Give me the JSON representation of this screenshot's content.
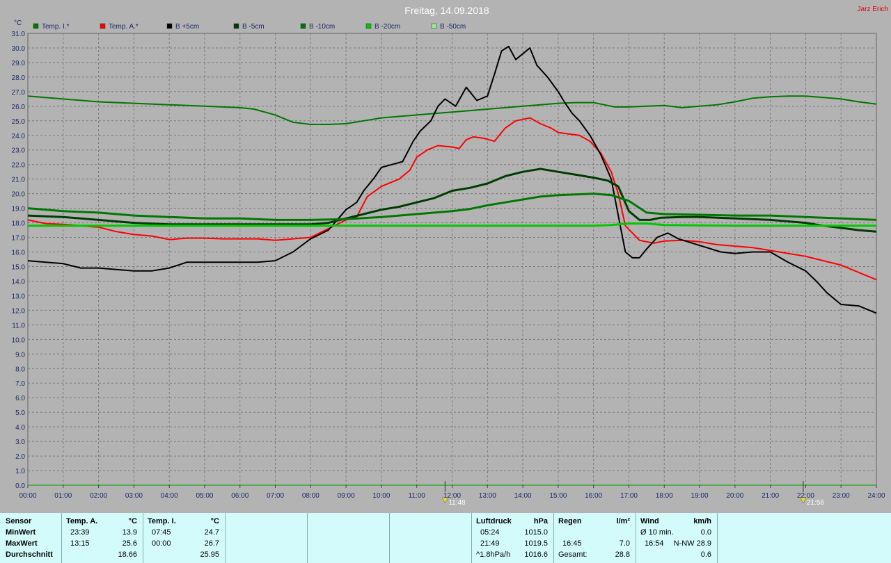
{
  "header": {
    "title": "Freitag, 14.09.2018",
    "author": "Jarz Erich"
  },
  "chart_data": {
    "type": "line",
    "ylabel": "°C",
    "ylim": [
      0,
      31
    ],
    "y_ticks": [
      "0.0",
      "1.0",
      "2.0",
      "3.0",
      "4.0",
      "5.0",
      "6.0",
      "7.0",
      "8.0",
      "9.0",
      "10.0",
      "11.0",
      "12.0",
      "13.0",
      "14.0",
      "15.0",
      "16.0",
      "17.0",
      "18.0",
      "19.0",
      "20.0",
      "21.0",
      "22.0",
      "23.0",
      "24.0",
      "25.0",
      "26.0",
      "27.0",
      "28.0",
      "29.0",
      "30.0",
      "31.0"
    ],
    "x_ticks": [
      "00:00",
      "01:00",
      "02:00",
      "03:00",
      "04:00",
      "05:00",
      "06:00",
      "07:00",
      "08:00",
      "09:00",
      "10:00",
      "11:00",
      "12:00",
      "13:00",
      "14:00",
      "15:00",
      "16:00",
      "17:00",
      "18:00",
      "19:00",
      "20:00",
      "21:00",
      "22:00",
      "23:00",
      "24:00"
    ],
    "xlim": [
      0,
      24
    ],
    "grid": true,
    "legend_position": "top",
    "markers": [
      {
        "time_hours": 11.8,
        "label": "11:48"
      },
      {
        "time_hours": 21.93,
        "label": "21:56"
      }
    ],
    "series": [
      {
        "name": "Temp. I.*",
        "color": "#007800",
        "width": 2,
        "x": [
          0,
          1,
          2,
          3,
          4,
          5,
          6,
          6.4,
          7,
          7.5,
          8,
          8.5,
          9,
          9.5,
          10,
          10.5,
          11,
          11.5,
          12,
          12.5,
          13,
          13.5,
          14,
          14.5,
          15,
          15.5,
          16,
          16.3,
          16.6,
          17,
          17.5,
          18,
          18.5,
          19,
          19.5,
          20,
          20.5,
          21,
          21.5,
          22,
          22.5,
          23,
          23.5,
          24
        ],
        "y": [
          26.7,
          26.5,
          26.3,
          26.2,
          26.1,
          26.0,
          25.9,
          25.8,
          25.4,
          24.9,
          24.75,
          24.75,
          24.8,
          25.0,
          25.2,
          25.3,
          25.4,
          25.5,
          25.6,
          25.7,
          25.8,
          25.9,
          26.0,
          26.1,
          26.2,
          26.25,
          26.25,
          26.1,
          25.95,
          25.95,
          26.0,
          26.05,
          25.9,
          26.0,
          26.1,
          26.3,
          26.55,
          26.65,
          26.7,
          26.7,
          26.6,
          26.5,
          26.3,
          26.15
        ]
      },
      {
        "name": "Temp. A.*",
        "color": "#ff0000",
        "width": 2,
        "x": [
          0,
          0.5,
          1,
          1.5,
          2,
          2.5,
          3,
          3.5,
          4,
          4.5,
          5,
          5.5,
          6,
          6.5,
          7,
          7.5,
          8,
          8.5,
          9,
          9.3,
          9.6,
          10,
          10.5,
          10.8,
          11,
          11.3,
          11.6,
          12,
          12.2,
          12.4,
          12.6,
          12.9,
          13.2,
          13.5,
          13.8,
          14,
          14.2,
          14.5,
          14.8,
          15,
          15.3,
          15.6,
          15.9,
          16.2,
          16.5,
          16.7,
          16.9,
          17.3,
          17.7,
          18,
          18.5,
          19,
          19.5,
          20,
          20.5,
          21,
          21.5,
          22,
          22.5,
          23,
          23.5,
          24
        ],
        "y": [
          18.2,
          17.95,
          17.9,
          17.8,
          17.7,
          17.4,
          17.2,
          17.1,
          16.85,
          16.95,
          16.95,
          16.9,
          16.9,
          16.9,
          16.8,
          16.9,
          17.0,
          17.6,
          18.2,
          18.4,
          19.8,
          20.5,
          21.0,
          21.6,
          22.5,
          23.0,
          23.3,
          23.2,
          23.1,
          23.7,
          23.9,
          23.8,
          23.6,
          24.5,
          25.0,
          25.1,
          25.2,
          24.8,
          24.5,
          24.2,
          24.1,
          24.0,
          23.6,
          22.8,
          21.5,
          20.0,
          17.8,
          16.8,
          16.6,
          16.75,
          16.8,
          16.7,
          16.5,
          16.4,
          16.3,
          16.1,
          15.9,
          15.7,
          15.4,
          15.1,
          14.6,
          14.1
        ]
      },
      {
        "name": "B +5cm",
        "color": "#000000",
        "width": 2,
        "x": [
          0,
          0.5,
          1,
          1.5,
          2,
          2.5,
          3,
          3.5,
          4,
          4.5,
          5,
          5.5,
          6,
          6.5,
          7,
          7.5,
          8,
          8.5,
          9,
          9.3,
          9.5,
          9.8,
          10,
          10.3,
          10.6,
          10.9,
          11.1,
          11.4,
          11.6,
          11.8,
          12.1,
          12.4,
          12.7,
          13.0,
          13.2,
          13.4,
          13.6,
          13.8,
          14.1,
          14.2,
          14.4,
          14.7,
          15.0,
          15.2,
          15.4,
          15.6,
          15.9,
          16.2,
          16.5,
          16.7,
          16.9,
          17.1,
          17.3,
          17.5,
          17.8,
          18.1,
          18.4,
          18.8,
          19.2,
          19.6,
          20,
          20.5,
          21,
          21.5,
          22,
          22.3,
          22.6,
          23,
          23.5,
          24
        ],
        "y": [
          15.4,
          15.3,
          15.2,
          14.9,
          14.9,
          14.8,
          14.7,
          14.7,
          14.9,
          15.3,
          15.3,
          15.3,
          15.3,
          15.3,
          15.4,
          16.0,
          16.9,
          17.5,
          18.9,
          19.4,
          20.2,
          21.1,
          21.8,
          22.0,
          22.2,
          23.6,
          24.3,
          25.0,
          26.0,
          26.5,
          26.0,
          27.3,
          26.4,
          26.7,
          28.2,
          29.8,
          30.1,
          29.2,
          29.8,
          30.0,
          28.8,
          28.0,
          27.0,
          26.2,
          25.5,
          25.0,
          24.0,
          22.7,
          21.0,
          18.5,
          16.0,
          15.6,
          15.6,
          16.2,
          17.0,
          17.3,
          16.9,
          16.6,
          16.3,
          16.0,
          15.9,
          16.0,
          16.0,
          15.3,
          14.7,
          14.0,
          13.2,
          12.4,
          12.3,
          11.8
        ]
      },
      {
        "name": "B -5cm",
        "color": "#003c00",
        "width": 3,
        "x": [
          0,
          1,
          2,
          3,
          4,
          5,
          5.4,
          8,
          8.5,
          9,
          9.5,
          10,
          10.5,
          11,
          11.5,
          12,
          12.5,
          13,
          13.5,
          14,
          14.5,
          15,
          15.5,
          16,
          16.4,
          16.7,
          17,
          17.3,
          17.6,
          17.9,
          18.5,
          19,
          20,
          21,
          22,
          22.5,
          23,
          23.5,
          24
        ],
        "y": [
          18.5,
          18.4,
          18.2,
          18.0,
          17.9,
          17.9,
          17.9,
          17.9,
          18.0,
          18.3,
          18.6,
          18.9,
          19.1,
          19.4,
          19.7,
          20.2,
          20.4,
          20.7,
          21.2,
          21.5,
          21.7,
          21.5,
          21.3,
          21.1,
          20.9,
          20.5,
          18.8,
          18.2,
          18.2,
          18.35,
          18.4,
          18.4,
          18.3,
          18.2,
          18.0,
          17.8,
          17.65,
          17.5,
          17.4
        ]
      },
      {
        "name": "B -10cm",
        "color": "#007800",
        "width": 3,
        "x": [
          0,
          1,
          2,
          3,
          4,
          5,
          6,
          7,
          8,
          9,
          10,
          11,
          12,
          12.5,
          13,
          13.5,
          14,
          14.5,
          15,
          15.5,
          16,
          16.5,
          17,
          17.5,
          18,
          19,
          20,
          21,
          22,
          23,
          24
        ],
        "y": [
          19.0,
          18.8,
          18.7,
          18.5,
          18.4,
          18.3,
          18.3,
          18.2,
          18.2,
          18.25,
          18.4,
          18.6,
          18.8,
          18.95,
          19.2,
          19.4,
          19.6,
          19.8,
          19.9,
          19.95,
          20.0,
          19.9,
          19.5,
          18.7,
          18.6,
          18.55,
          18.5,
          18.5,
          18.4,
          18.3,
          18.2
        ]
      },
      {
        "name": "B -20cm",
        "color": "#00c800",
        "width": 3,
        "x": [
          0,
          4,
          8,
          12,
          16,
          16.5,
          17,
          17.5,
          18,
          20,
          22,
          24
        ],
        "y": [
          17.8,
          17.8,
          17.8,
          17.8,
          17.8,
          17.85,
          17.95,
          17.95,
          17.85,
          17.8,
          17.8,
          17.8
        ]
      },
      {
        "name": "B -50cm",
        "color": "#90ee90",
        "width": 2,
        "x": [],
        "y": []
      }
    ]
  },
  "stats": {
    "sensor": {
      "title": "Sensor",
      "min": "MinWert",
      "max": "MaxWert",
      "avg": "Durchschnitt"
    },
    "temp_a": {
      "title": "Temp. A.",
      "unit": "°C",
      "min_time": "23:39",
      "min_val": "13.9",
      "max_time": "13:15",
      "max_val": "25.6",
      "avg_val": "18.66"
    },
    "temp_i": {
      "title": "Temp. I.",
      "unit": "°C",
      "min_time": "07:45",
      "min_val": "24.7",
      "max_time": "00:00",
      "max_val": "26.7",
      "avg_val": "25.95"
    },
    "pressure": {
      "title": "Luftdruck",
      "unit": "hPa",
      "min_time": "05:24",
      "min_val": "1015.0",
      "max_time": "21:49",
      "max_val": "1019.5",
      "trend": "^1.8hPa/h",
      "trend_val": "1016.6"
    },
    "rain": {
      "title": "Regen",
      "unit": "l/m²",
      "max_time": "16:45",
      "max_val": "7.0",
      "total_label": "Gesamt:",
      "total_val": "28.8"
    },
    "wind": {
      "title": "Wind",
      "unit": "km/h",
      "avg_label": "Ø 10 min.",
      "avg_val": "0.0",
      "max_time": "16:54",
      "max_val": "N-NW 28.9",
      "mean_val": "0.6"
    }
  }
}
